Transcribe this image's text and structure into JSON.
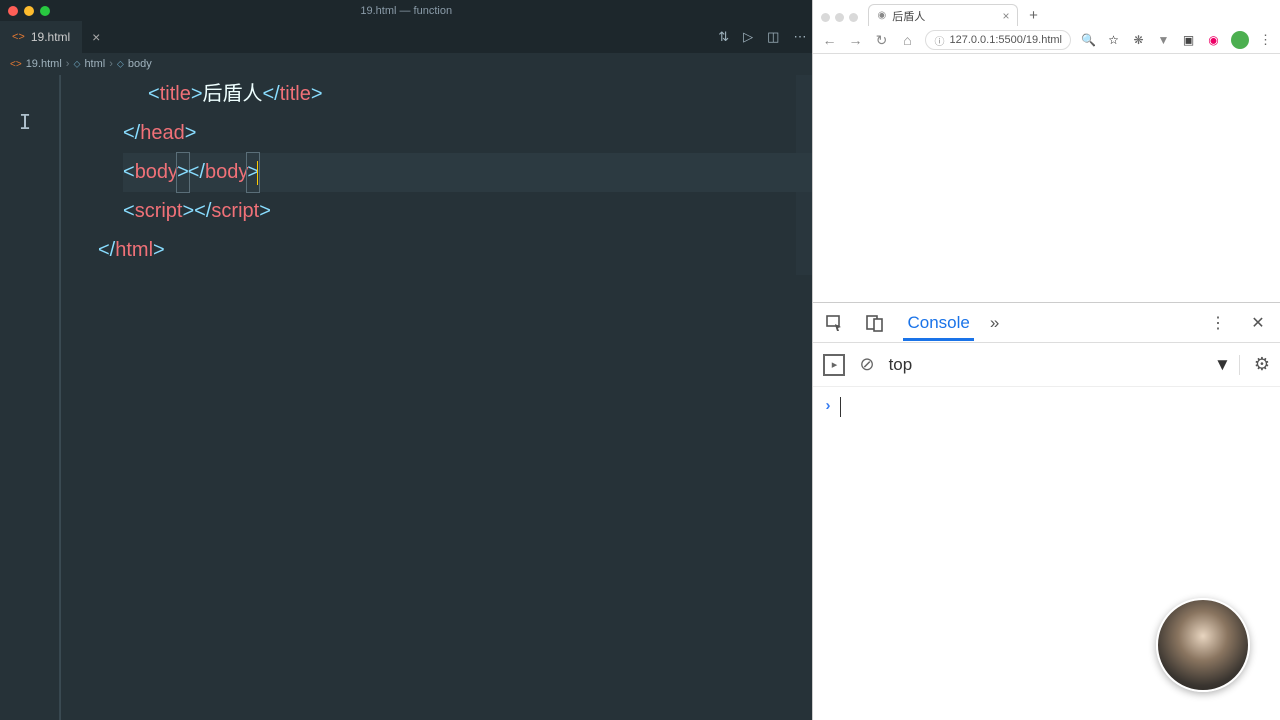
{
  "editor": {
    "window_title": "19.html — function",
    "tab_name": "19.html",
    "breadcrumb": {
      "file": "19.html",
      "p1": "html",
      "p2": "body"
    },
    "code": {
      "title_tag": "title",
      "title_text": "后盾人",
      "head": "head",
      "body": "body",
      "script": "script",
      "html": "html"
    }
  },
  "browser": {
    "tab_title": "后盾人",
    "url": "127.0.0.1:5500/19.html"
  },
  "devtools": {
    "tab_console": "Console",
    "context": "top"
  }
}
